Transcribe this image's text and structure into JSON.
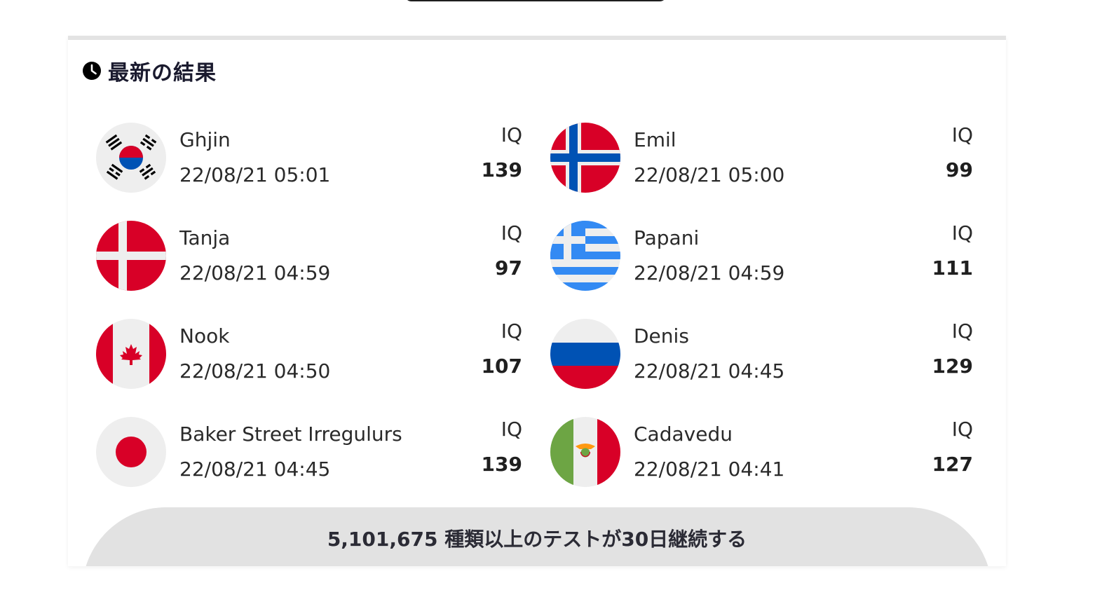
{
  "section": {
    "title": "最新の結果",
    "icon": "clock-icon"
  },
  "results": [
    {
      "name": "Ghjin",
      "time": "22/08/21 05:01",
      "iq_label": "IQ",
      "iq": "139",
      "flag": "south-korea-flag-icon"
    },
    {
      "name": "Emil",
      "time": "22/08/21 05:00",
      "iq_label": "IQ",
      "iq": "99",
      "flag": "norway-flag-icon"
    },
    {
      "name": "Tanja",
      "time": "22/08/21 04:59",
      "iq_label": "IQ",
      "iq": "97",
      "flag": "denmark-flag-icon"
    },
    {
      "name": "Papani",
      "time": "22/08/21 04:59",
      "iq_label": "IQ",
      "iq": "111",
      "flag": "greece-flag-icon"
    },
    {
      "name": "Nook",
      "time": "22/08/21 04:50",
      "iq_label": "IQ",
      "iq": "107",
      "flag": "canada-flag-icon"
    },
    {
      "name": "Denis",
      "time": "22/08/21 04:45",
      "iq_label": "IQ",
      "iq": "129",
      "flag": "russia-flag-icon"
    },
    {
      "name": "Baker Street Irregulurs",
      "time": "22/08/21 04:45",
      "iq_label": "IQ",
      "iq": "139",
      "flag": "japan-flag-icon"
    },
    {
      "name": "Cadavedu",
      "time": "22/08/21 04:41",
      "iq_label": "IQ",
      "iq": "127",
      "flag": "mexico-flag-icon"
    }
  ],
  "footer": {
    "text": "5,101,675 種類以上のテストが30日継続する"
  },
  "colors": {
    "red": "#d80027",
    "blue": "#0052b4",
    "greek_blue": "#338af3",
    "green": "#6da544",
    "light_gray": "#eeeeee",
    "footer_bg": "#e2e2e2"
  }
}
